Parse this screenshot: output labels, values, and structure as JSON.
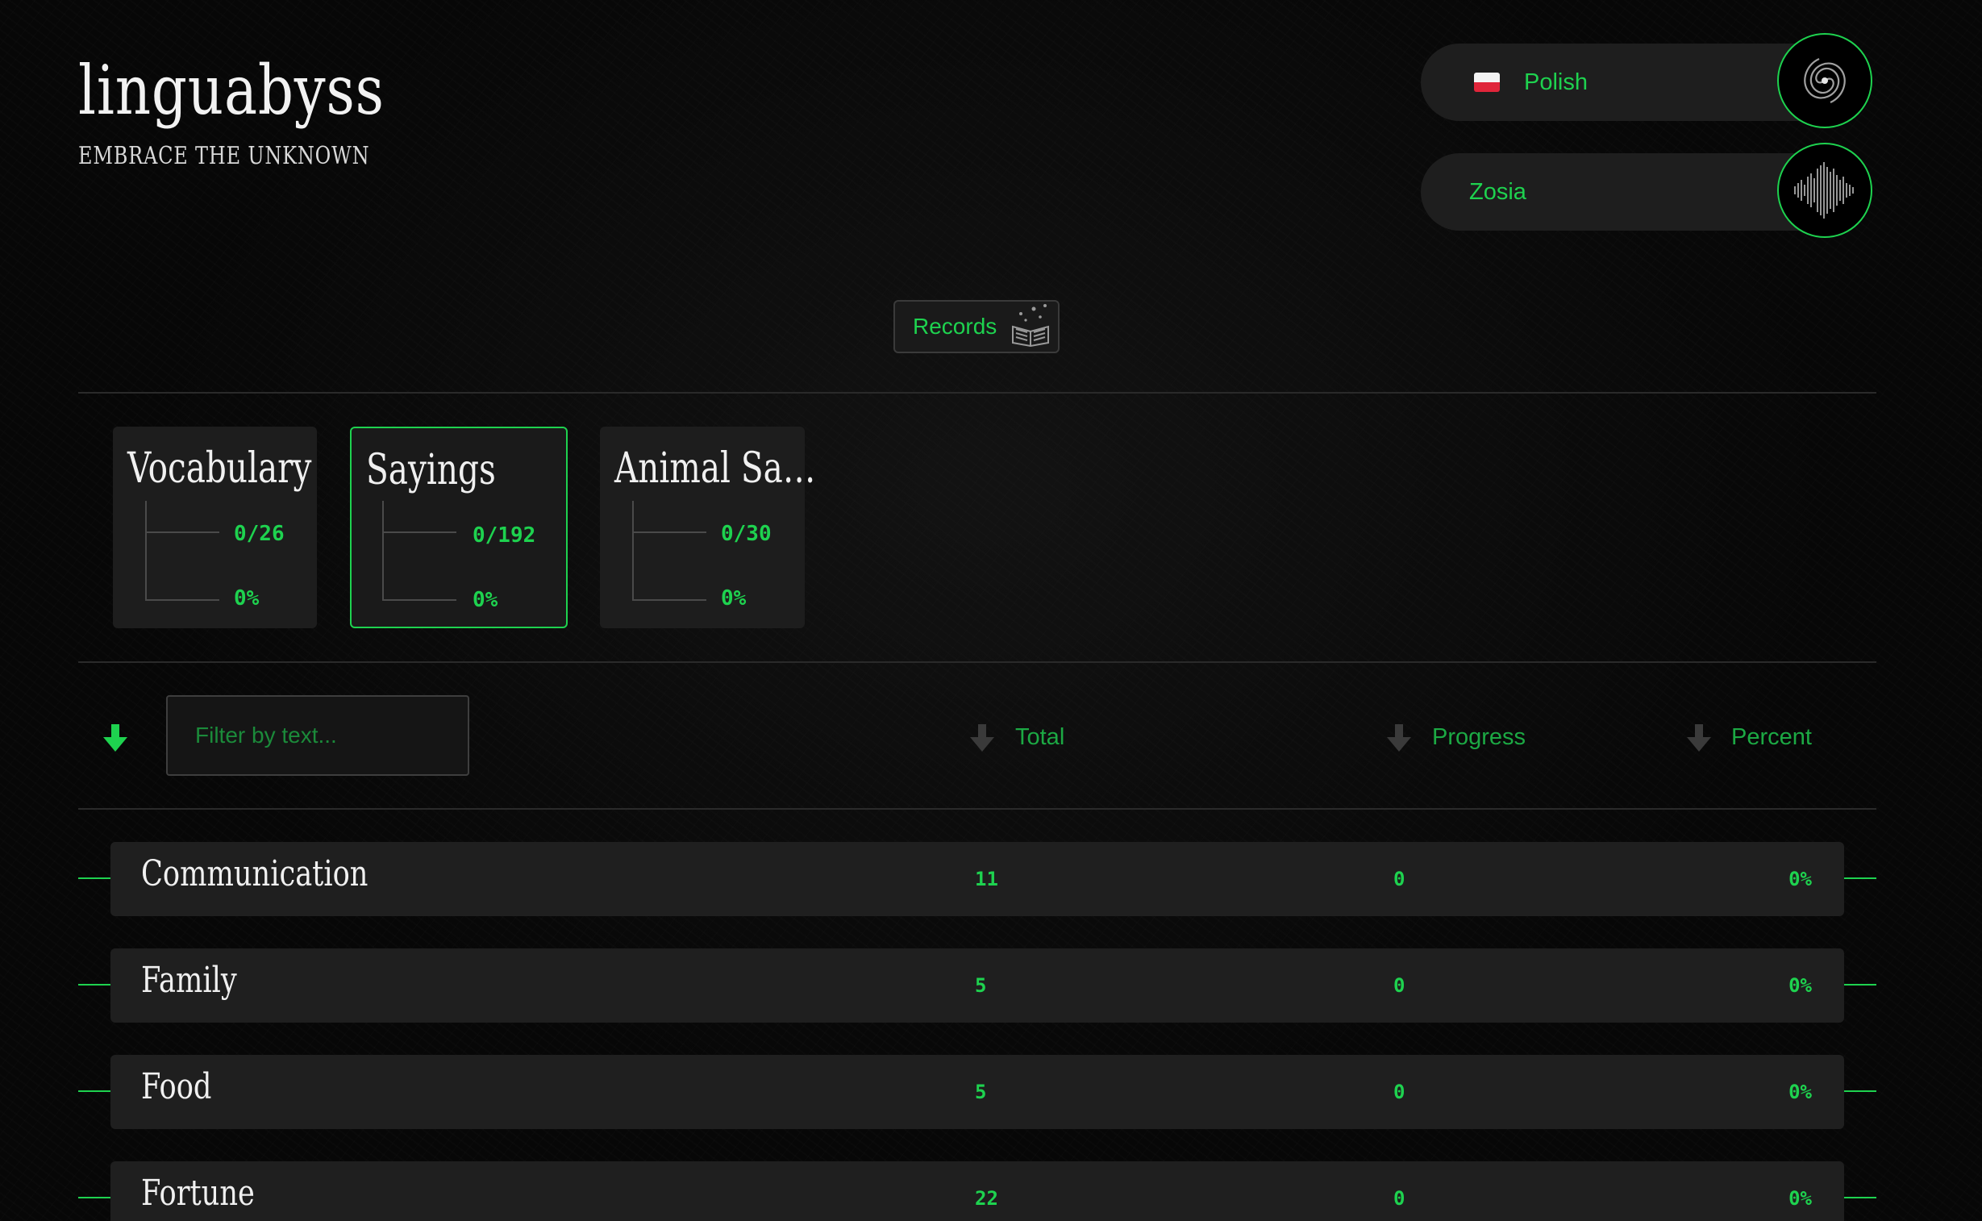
{
  "brand": {
    "title": "linguabyss",
    "tagline": "EMBRACE THE UNKNOWN"
  },
  "language": {
    "label": "Polish",
    "flag": "poland-flag"
  },
  "user": {
    "name": "Zosia"
  },
  "records": {
    "label": "Records",
    "icon": "open-book-icon"
  },
  "categories": [
    {
      "title": "Vocabulary",
      "count": "0/26",
      "percent": "0%",
      "active": false
    },
    {
      "title": "Sayings",
      "count": "0/192",
      "percent": "0%",
      "active": true
    },
    {
      "title": "Animal Sa…",
      "count": "0/30",
      "percent": "0%",
      "active": false
    }
  ],
  "filter": {
    "placeholder": "Filter by text..."
  },
  "columns": {
    "total": "Total",
    "progress": "Progress",
    "percent": "Percent"
  },
  "rows": [
    {
      "name": "Communication",
      "total": "11",
      "progress": "0",
      "percent": "0%"
    },
    {
      "name": "Family",
      "total": "5",
      "progress": "0",
      "percent": "0%"
    },
    {
      "name": "Food",
      "total": "5",
      "progress": "0",
      "percent": "0%"
    },
    {
      "name": "Fortune",
      "total": "22",
      "progress": "0",
      "percent": "0%"
    }
  ],
  "colors": {
    "accent": "#1ed24f",
    "background": "#070707",
    "panel": "#1f1f1f"
  }
}
